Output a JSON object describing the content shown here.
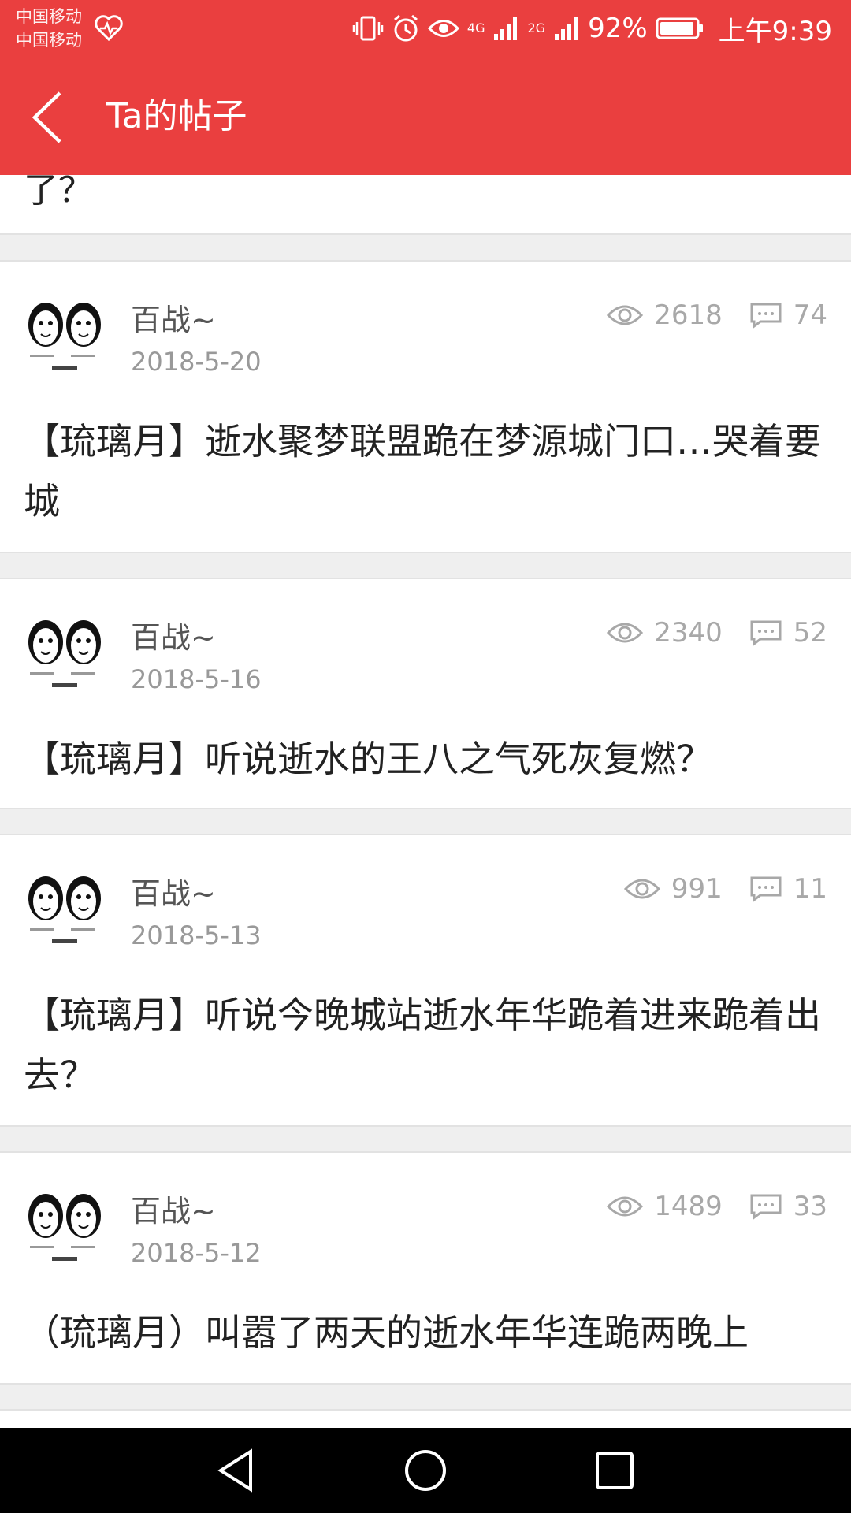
{
  "status_bar": {
    "carrier_1": "中国移动",
    "carrier_2": "中国移动",
    "network_1": "4G",
    "network_2": "2G",
    "battery": "92%",
    "time": "上午9:39"
  },
  "header": {
    "title": "Ta的帖子",
    "background_color": "#ea3f3f"
  },
  "partial_post": {
    "text_fragment": "了？"
  },
  "posts": [
    {
      "author": "百战~",
      "date": "2018-5-20",
      "views": "2618",
      "comments": "74",
      "title": "【琉璃月】逝水聚梦联盟跪在梦源城门口…哭着要城"
    },
    {
      "author": "百战~",
      "date": "2018-5-16",
      "views": "2340",
      "comments": "52",
      "title": "【琉璃月】听说逝水的王八之气死灰复燃？"
    },
    {
      "author": "百战~",
      "date": "2018-5-13",
      "views": "991",
      "comments": "11",
      "title": "【琉璃月】听说今晚城站逝水年华跪着进来跪着出去？"
    },
    {
      "author": "百战~",
      "date": "2018-5-12",
      "views": "1489",
      "comments": "33",
      "title": "（琉璃月）叫嚣了两天的逝水年华连跪两晚上"
    }
  ],
  "icons": {
    "views": "eye-icon",
    "comments": "comment-icon",
    "nav_back": "triangle-back-icon",
    "nav_home": "circle-home-icon",
    "nav_recent": "square-recent-icon"
  }
}
